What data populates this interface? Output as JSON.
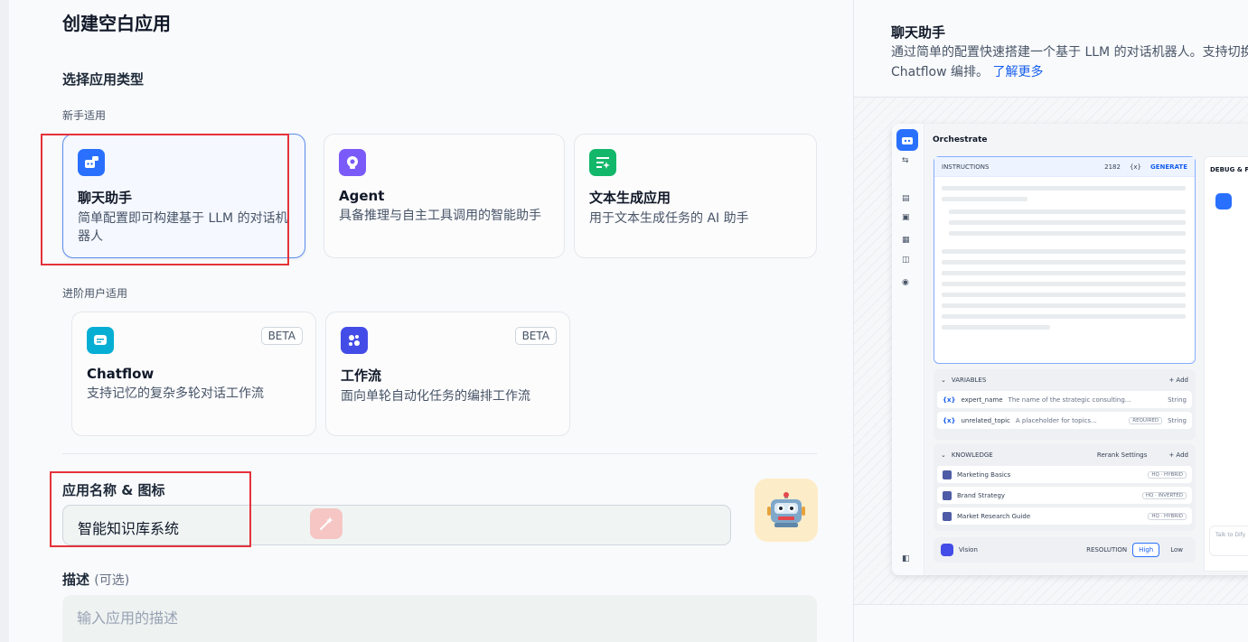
{
  "left": {
    "page_title": "创建空白应用",
    "section_title": "选择应用类型",
    "beginner_label": "新手适用",
    "advanced_label": "进阶用户适用",
    "cards": [
      {
        "name": "聊天助手",
        "desc": "简单配置即可构建基于 LLM 的对话机器人",
        "icon": "chat-bot-icon",
        "color": "#2970ff",
        "selected": true
      },
      {
        "name": "Agent",
        "desc": "具备推理与自主工具调用的智能助手",
        "icon": "agent-icon",
        "color": "#7a5af8"
      },
      {
        "name": "文本生成应用",
        "desc": "用于文本生成任务的 AI 助手",
        "icon": "text-gen-icon",
        "color": "#12b76a"
      },
      {
        "name": "Chatflow",
        "desc": "支持记忆的复杂多轮对话工作流",
        "icon": "chatflow-icon",
        "color": "#06aed4",
        "badge": "BETA"
      },
      {
        "name": "工作流",
        "desc": "面向单轮自动化任务的编排工作流",
        "icon": "workflow-icon",
        "color": "#444ce7",
        "badge": "BETA"
      }
    ],
    "name_label": "应用名称 & 图标",
    "name_value": "智能知识库系统",
    "desc_label": "描述",
    "desc_optional": "(可选)",
    "desc_placeholder": "输入应用的描述"
  },
  "right": {
    "title": "聊天助手",
    "desc": "通过简单的配置快速搭建一个基于 LLM 的对话机器人。支持切换为",
    "desc2": "Chatflow 编排。",
    "learn_more": "了解更多",
    "preview": {
      "title": "Orchestrate",
      "instructions": "INSTRUCTIONS",
      "count": "2182",
      "var_symbol": "{x}",
      "generate": "GENERATE",
      "variables_label": "VARIABLES",
      "add": "+ Add",
      "variables": [
        {
          "symbol": "{x}",
          "name": "expert_name",
          "desc": "The name of the strategic consulting...",
          "required": "",
          "type": "String"
        },
        {
          "symbol": "{x}",
          "name": "unrelated_topic",
          "desc": "A placeholder for topics...",
          "required": "REQUIRED",
          "type": "String"
        }
      ],
      "knowledge_label": "KNOWLEDGE",
      "rerank": "Rerank Settings",
      "knowledge": [
        {
          "name": "Marketing Basics",
          "tag": "HQ · HYBRID"
        },
        {
          "name": "Brand Strategy",
          "tag": "HQ · INVERTED"
        },
        {
          "name": "Market Research Guide",
          "tag": "HQ · HYBRID"
        }
      ],
      "vision": "Vision",
      "resolution": "RESOLUTION",
      "high": "High",
      "low": "Low",
      "debug": "DEBUG & PREVIEW",
      "talk": "Talk to Dify"
    }
  }
}
